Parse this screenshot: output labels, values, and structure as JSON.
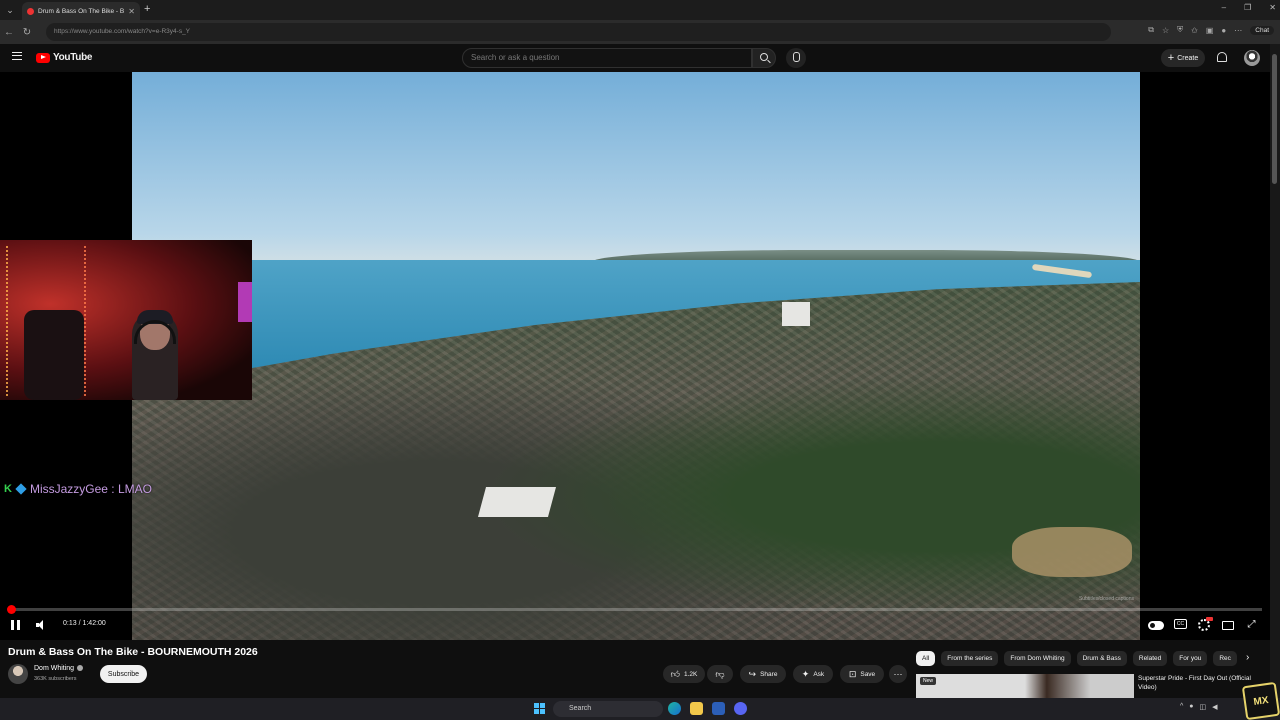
{
  "browser": {
    "tab_title": "Drum & Bass On The Bike - B",
    "url": "https://www.youtube.com/watch?v=e-R3y4-s_Y",
    "chat_label": "Chat"
  },
  "youtube": {
    "logo_text": "YouTube",
    "search_placeholder": "Search or ask a question",
    "create_label": "Create"
  },
  "player": {
    "current_time": "0:13",
    "duration": "1:42:00",
    "time_display": "0:13 / 1:42:00",
    "progress_fraction": 0.002,
    "subtitles_hint": "Subtitles/closed captions"
  },
  "stream_overlay": {
    "chat_username": "MissJazzyGee",
    "chat_message": "LMAO",
    "chat_line": "MissJazzyGee : LMAO"
  },
  "video": {
    "title": "Drum & Bass On The Bike - BOURNEMOUTH 2026",
    "channel_name": "Dom Whiting",
    "subscribers": "363K subscribers",
    "subscribe_label": "Subscribe",
    "likes": "1.2K",
    "share_label": "Share",
    "ask_label": "Ask",
    "save_label": "Save"
  },
  "sidebar_chips": [
    "All",
    "From the series",
    "From Dom Whiting",
    "Drum & Bass",
    "Related",
    "For you",
    "Rec"
  ],
  "recommendation": {
    "badge": "New",
    "title": "Superstar Pride - First Day Out (Official Video)"
  },
  "taskbar": {
    "search_label": "Search"
  },
  "colors": {
    "youtube_red": "#ff0000",
    "background": "#0f0f0f",
    "chat_username": "#c49be0"
  }
}
